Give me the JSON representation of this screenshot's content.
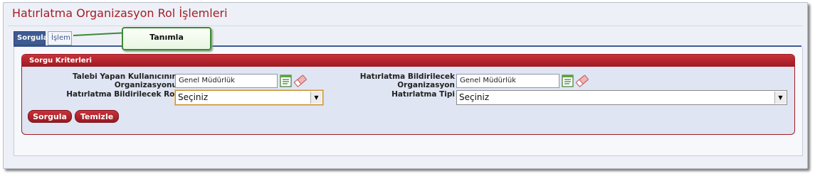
{
  "page": {
    "title": "Hatırlatma Organizasyon Rol İşlemleri"
  },
  "tabs": [
    {
      "label": "Sorgula",
      "active": true
    },
    {
      "label": "İşlem",
      "active": false
    }
  ],
  "tooltip": {
    "text": "Tanımla"
  },
  "panel": {
    "title": "Sorgu Kriterleri",
    "fields": {
      "req_org": {
        "label_line1": "Talebi Yapan Kullanıcının",
        "label_line2": "Organizasyonu",
        "value": "Genel Müdürlük"
      },
      "notify_org": {
        "label_line1": "Hatırlatma Bildirilecek",
        "label_line2": "Organizasyon",
        "value": "Genel Müdürlük"
      },
      "notify_role": {
        "label": "Hatırlatma Bildirilecek Rol",
        "value": "Seçiniz"
      },
      "notify_type": {
        "label": "Hatırlatma Tipi",
        "value": "Seçiniz"
      }
    },
    "buttons": {
      "query": "Sorgula",
      "clear": "Temizle"
    }
  },
  "icons": {
    "list": "list-icon",
    "eraser": "eraser-icon",
    "dropdown": "chevron-down-icon"
  },
  "colors": {
    "brand_red": "#a41e25",
    "tab_blue": "#3e5b91",
    "panel_bg": "#dfe5f3",
    "tooltip_border": "#3c8a35"
  }
}
